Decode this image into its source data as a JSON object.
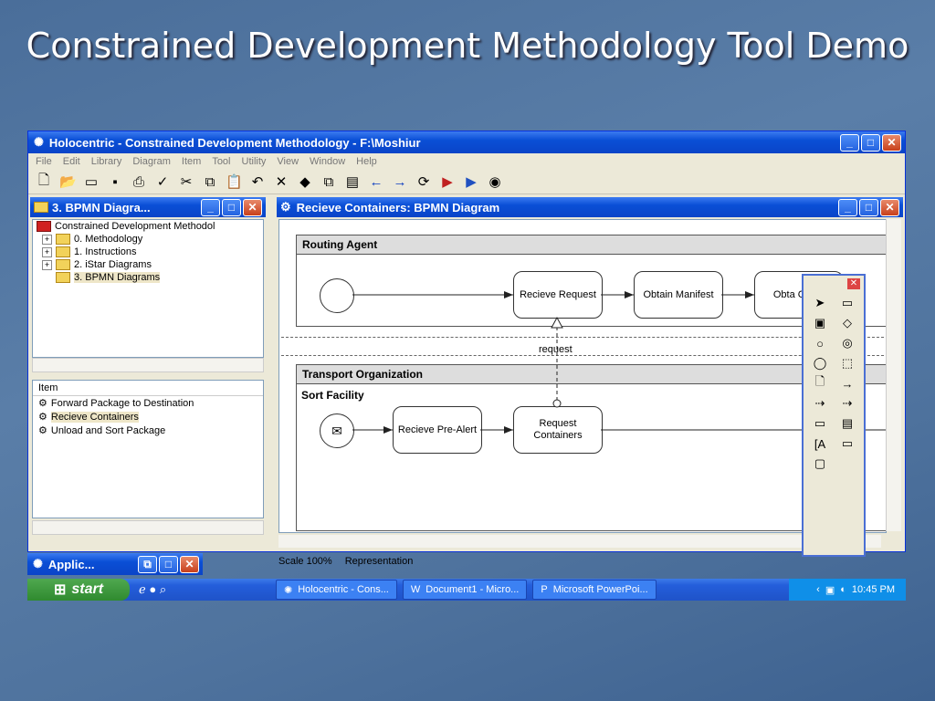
{
  "slide": {
    "title": "Constrained Development Methodology Tool Demo"
  },
  "app": {
    "title": "Holocentric - Constrained Development Methodology - F:\\Moshiur",
    "menu": [
      "File",
      "Edit",
      "Library",
      "Diagram",
      "Item",
      "Tool",
      "Utility",
      "View",
      "Window",
      "Help"
    ],
    "toolbar_icons": [
      "new-icon",
      "open-icon",
      "folder-icon",
      "save-icon",
      "print-icon",
      "spell-icon",
      "cut-icon",
      "copy-icon",
      "paste-icon",
      "undo-icon",
      "delete-icon",
      "tool1-icon",
      "tool2-icon",
      "tool3-icon",
      "back-icon",
      "forward-icon",
      "refresh-icon",
      "export-icon",
      "import-icon",
      "eye-icon"
    ]
  },
  "left_pane": {
    "title": "3. BPMN Diagra...",
    "tree": [
      {
        "label": "Constrained Development Methodol",
        "expanded": true
      },
      {
        "label": "0. Methodology"
      },
      {
        "label": "1. Instructions"
      },
      {
        "label": "2. iStar Diagrams"
      },
      {
        "label": "3. BPMN Diagrams",
        "selected": true
      }
    ],
    "items_header": "Item",
    "items": [
      "Forward Package to Destination",
      "Recieve Containers",
      "Unload and Sort Package"
    ]
  },
  "diagram": {
    "title": "Recieve Containers: BPMN Diagram",
    "lane1": "Routing Agent",
    "lane2": "Transport Organization",
    "sublane": "Sort Facility",
    "tasks": {
      "recieve_request": "Recieve Request",
      "obtain_manifest": "Obtain Manifest",
      "obtain_contact": "Obta Conta",
      "recieve_prealert": "Recieve Pre-Alert",
      "request_containers": "Request Containers"
    },
    "message_label": "request"
  },
  "status": {
    "scale": "Scale 100%",
    "mode": "Representation"
  },
  "mini_app": {
    "title": "Applic..."
  },
  "taskbar": {
    "start": "start",
    "tasks": [
      "Holocentric - Cons...",
      "Document1 - Micro...",
      "Microsoft PowerPoi..."
    ],
    "clock": "10:45 PM"
  }
}
